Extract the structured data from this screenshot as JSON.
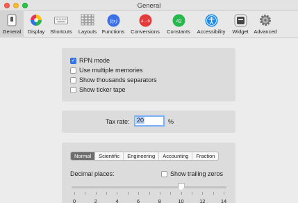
{
  "window": {
    "title": "General"
  },
  "toolbar": {
    "items": [
      {
        "label": "General",
        "icon": "switch-icon"
      },
      {
        "label": "Display",
        "icon": "color-wheel-icon"
      },
      {
        "label": "Shortcuts",
        "icon": "keyboard-icon"
      },
      {
        "label": "Layouts",
        "icon": "grid-icon"
      },
      {
        "label": "Functions",
        "icon": "function-icon",
        "glyph": "f(x)"
      },
      {
        "label": "Conversions",
        "icon": "conversion-icon",
        "glyph": "a→b"
      },
      {
        "label": "Constants",
        "icon": "constants-icon",
        "glyph": "42"
      },
      {
        "label": "Accessibility",
        "icon": "accessibility-icon"
      },
      {
        "label": "Widget",
        "icon": "widget-icon"
      },
      {
        "label": "Advanced",
        "icon": "gear-icon"
      }
    ]
  },
  "options": {
    "rpn_mode": {
      "label": "RPN mode",
      "checked": true
    },
    "multiple_memories": {
      "label": "Use multiple memories",
      "checked": false
    },
    "thousands_separators": {
      "label": "Show thousands separators",
      "checked": false
    },
    "ticker_tape": {
      "label": "Show ticker tape",
      "checked": false
    }
  },
  "tax": {
    "label": "Tax rate:",
    "value": "20",
    "unit": "%"
  },
  "format": {
    "tabs": [
      "Normal",
      "Scientific",
      "Engineering",
      "Accounting",
      "Fraction"
    ],
    "selected": "Normal"
  },
  "decimal": {
    "label": "Decimal places:",
    "trailing_zeros_label": "Show trailing zeros",
    "trailing_zeros_checked": false,
    "value": 10,
    "min": 0,
    "max": 14,
    "tick_labels": [
      "0",
      "2",
      "4",
      "6",
      "8",
      "10",
      "12",
      "14"
    ]
  }
}
